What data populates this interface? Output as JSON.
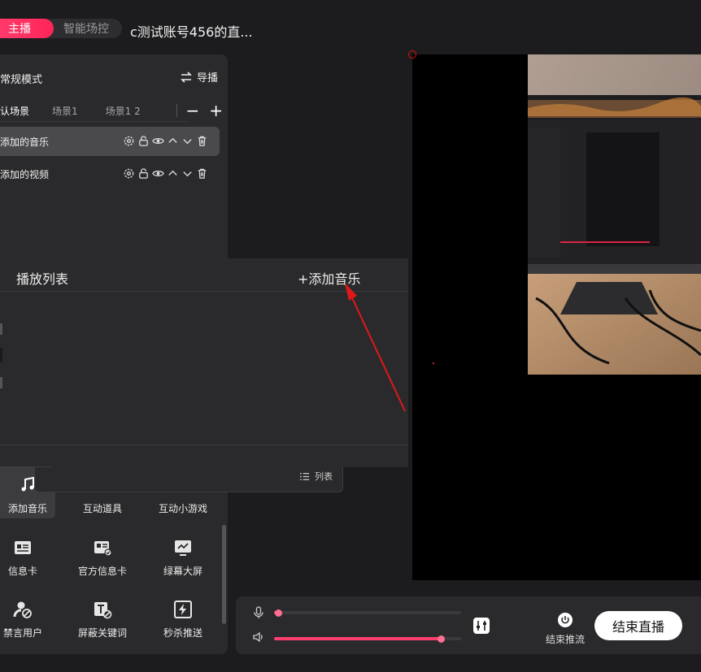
{
  "header": {
    "mode_tabs": [
      {
        "label": "主播",
        "active": true
      },
      {
        "label": "智能场控",
        "active": false
      }
    ],
    "room_title": "c测试账号456的直..."
  },
  "scene_panel": {
    "mode_label": "常规模式",
    "director_label": "导播",
    "tabs": [
      "认场景",
      "场景1",
      "场景1 2"
    ],
    "sources": [
      {
        "label": "添加的音乐",
        "selected": true
      },
      {
        "label": "添加的视频",
        "selected": false
      }
    ]
  },
  "playlist": {
    "title": "播放列表",
    "add_label": "+添加音乐",
    "list_label": "列表"
  },
  "tools": [
    {
      "label": "添加音乐",
      "icon": "music-note-icon",
      "selected": true
    },
    {
      "label": "互动道具",
      "icon": "gift-icon",
      "selected": false
    },
    {
      "label": "互动小游戏",
      "icon": "gamepad-icon",
      "selected": false
    },
    {
      "label": "信息卡",
      "icon": "info-card-icon",
      "selected": false
    },
    {
      "label": "官方信息卡",
      "icon": "official-card-icon",
      "selected": false
    },
    {
      "label": "绿幕大屏",
      "icon": "green-screen-icon",
      "selected": false
    },
    {
      "label": "禁言用户",
      "icon": "mute-user-icon",
      "selected": false
    },
    {
      "label": "屏蔽关键词",
      "icon": "block-keyword-icon",
      "selected": false
    },
    {
      "label": "秒杀推送",
      "icon": "flash-sale-icon",
      "selected": false
    }
  ],
  "controls": {
    "mic_level": 0.02,
    "speaker_level": 0.89,
    "stop_push_label": "结束推流",
    "end_live_label": "结束直播"
  },
  "colors": {
    "accent": "#ff3d6e",
    "panel": "#2a2a2c",
    "background": "#1c1c1e",
    "annotation": "#e01818"
  }
}
